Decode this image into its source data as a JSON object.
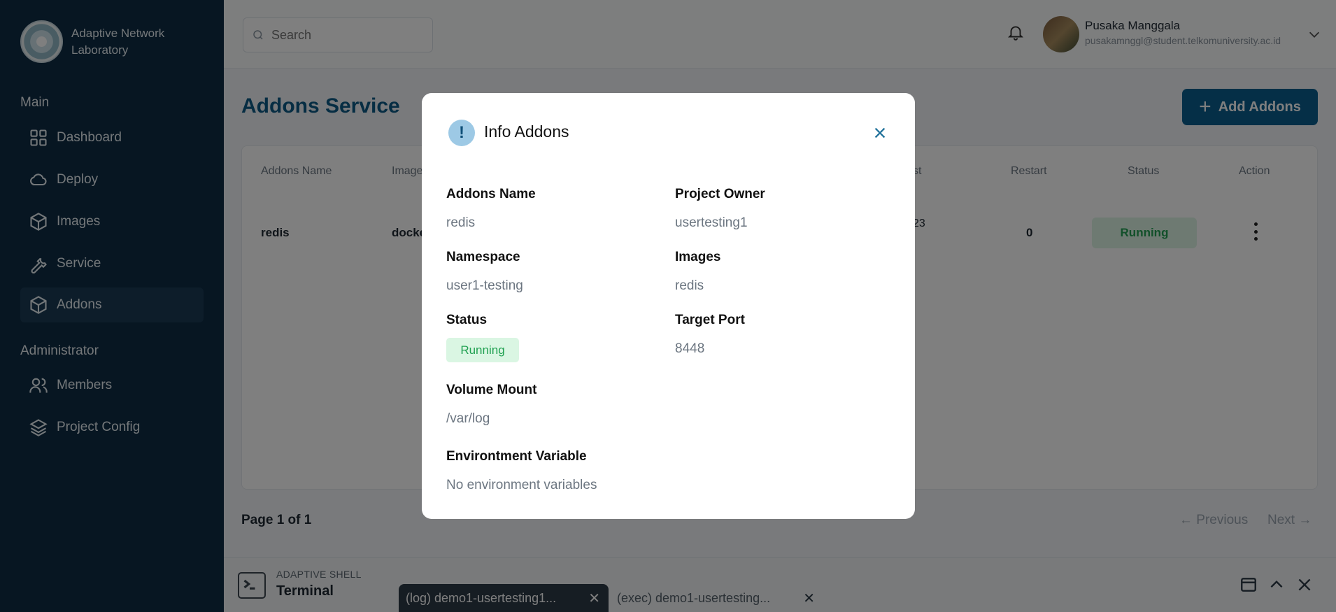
{
  "sidebar": {
    "brand": "Adaptive Network Laboratory",
    "section_main": "Main",
    "section_admin": "Administrator",
    "items": [
      {
        "label": "Dashboard",
        "icon": "grid-icon"
      },
      {
        "label": "Deploy",
        "icon": "cloud-icon"
      },
      {
        "label": "Images",
        "icon": "cube-icon"
      },
      {
        "label": "Service",
        "icon": "wrench-icon"
      },
      {
        "label": "Addons",
        "icon": "cube-icon",
        "active": true
      },
      {
        "label": "Members",
        "icon": "users-icon"
      },
      {
        "label": "Project Config",
        "icon": "layers-icon"
      }
    ]
  },
  "header": {
    "search_placeholder": "Search",
    "user_name": "Pusaka Manggala",
    "user_email": "pusakamnggl@student.telkomuniversity.ac.id"
  },
  "page": {
    "title": "Addons Service",
    "add_button": "Add Addons",
    "add_button_icon": "+"
  },
  "table": {
    "columns": [
      "Addons Name",
      "Image",
      "st",
      "Restart",
      "Status",
      "Action"
    ],
    "row": {
      "name": "redis",
      "image": "docke",
      "created": "23",
      "restart": "0",
      "status": "Running"
    }
  },
  "pagination": {
    "page_text": "Page 1 of 1",
    "previous": "← Previous",
    "next": "Next →"
  },
  "terminal": {
    "subtitle": "ADAPTIVE SHELL",
    "title": "Terminal",
    "tabs": [
      {
        "label": "(log) demo1-usertesting1..."
      },
      {
        "label": "(exec) demo1-usertesting..."
      }
    ]
  },
  "modal": {
    "title": "Info Addons",
    "icon_glyph": "!",
    "close_glyph": "×",
    "fields": {
      "addons_name_label": "Addons Name",
      "addons_name_value": "redis",
      "project_owner_label": "Project Owner",
      "project_owner_value": "usertesting1",
      "namespace_label": "Namespace",
      "namespace_value": "user1-testing",
      "images_label": "Images",
      "images_value": "redis",
      "status_label": "Status",
      "status_value": "Running",
      "target_port_label": "Target Port",
      "target_port_value": "8448",
      "volume_mount_label": "Volume Mount",
      "volume_mount_value": "/var/log",
      "env_label": "Environtment Variable",
      "env_value": "No environment variables"
    }
  },
  "colors": {
    "sidebar_bg": "#0e2c44",
    "accent": "#0b5f8e",
    "status_green": "#21a152",
    "status_green_bg": "#daf6e3"
  }
}
